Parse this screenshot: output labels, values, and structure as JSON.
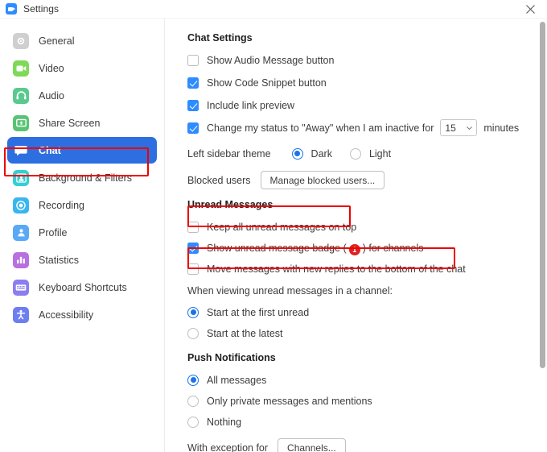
{
  "window": {
    "title": "Settings",
    "logo_icon": "zoom-logo-icon",
    "close_icon": "close-icon"
  },
  "sidebar": {
    "items": [
      {
        "label": "General",
        "icon": "gear-icon",
        "color": "#cfcfcf",
        "selected": false
      },
      {
        "label": "Video",
        "icon": "video-camera-icon",
        "color": "#7ed957",
        "selected": false
      },
      {
        "label": "Audio",
        "icon": "headphones-icon",
        "color": "#59c98d",
        "selected": false
      },
      {
        "label": "Share Screen",
        "icon": "share-screen-icon",
        "color": "#58c473",
        "selected": false
      },
      {
        "label": "Chat",
        "icon": "chat-bubble-icon",
        "color": "#ffffff",
        "selected": true
      },
      {
        "label": "Background & Filters",
        "icon": "person-frame-icon",
        "color": "#35cfd4",
        "selected": false
      },
      {
        "label": "Recording",
        "icon": "record-circle-icon",
        "color": "#39b5f0",
        "selected": false
      },
      {
        "label": "Profile",
        "icon": "person-icon",
        "color": "#5aa9f7",
        "selected": false
      },
      {
        "label": "Statistics",
        "icon": "bar-chart-icon",
        "color": "#b86fe0",
        "selected": false
      },
      {
        "label": "Keyboard Shortcuts",
        "icon": "keyboard-icon",
        "color": "#8a7ef0",
        "selected": false
      },
      {
        "label": "Accessibility",
        "icon": "accessibility-icon",
        "color": "#6d7ef0",
        "selected": false
      }
    ],
    "highlight_item": "Chat"
  },
  "chat_settings": {
    "heading": "Chat Settings",
    "checkboxes": [
      {
        "label": "Show Audio Message button",
        "checked": false
      },
      {
        "label": "Show Code Snippet button",
        "checked": true
      },
      {
        "label": "Include link preview",
        "checked": true
      }
    ],
    "away_status": {
      "checked": true,
      "prefix": "Change my status to \"Away\" when I am inactive for",
      "value": "15",
      "suffix": "minutes"
    },
    "sidebar_theme": {
      "label": "Left sidebar theme",
      "options": [
        {
          "label": "Dark",
          "selected": true
        },
        {
          "label": "Light",
          "selected": false
        }
      ]
    },
    "blocked_users": {
      "label": "Blocked users",
      "button": "Manage blocked users..."
    }
  },
  "unread_messages": {
    "heading": "Unread Messages",
    "options": [
      {
        "label": "Keep all unread messages on top",
        "checked": false,
        "highlighted": true
      },
      {
        "label": "Show unread message badge (",
        "checked": true,
        "highlighted": false,
        "badge": "1",
        "label_suffix": ") for channels"
      },
      {
        "label": "Move messages with new replies to the bottom of the chat",
        "checked": false,
        "highlighted": true
      }
    ],
    "viewing_label": "When viewing unread messages in a channel:",
    "viewing_options": [
      {
        "label": "Start at the first unread",
        "selected": true
      },
      {
        "label": "Start at the latest",
        "selected": false
      }
    ]
  },
  "push_notifications": {
    "heading": "Push Notifications",
    "options": [
      {
        "label": "All messages",
        "selected": true
      },
      {
        "label": "Only private messages and mentions",
        "selected": false
      },
      {
        "label": "Nothing",
        "selected": false
      }
    ],
    "exception": {
      "label": "With exception for",
      "button": "Channels..."
    }
  },
  "colors": {
    "accent": "#2d8cff",
    "selected_nav": "#2d6fe0",
    "annotation": "#ee0000",
    "badge": "#e02020",
    "radio": "#1a73e8"
  }
}
